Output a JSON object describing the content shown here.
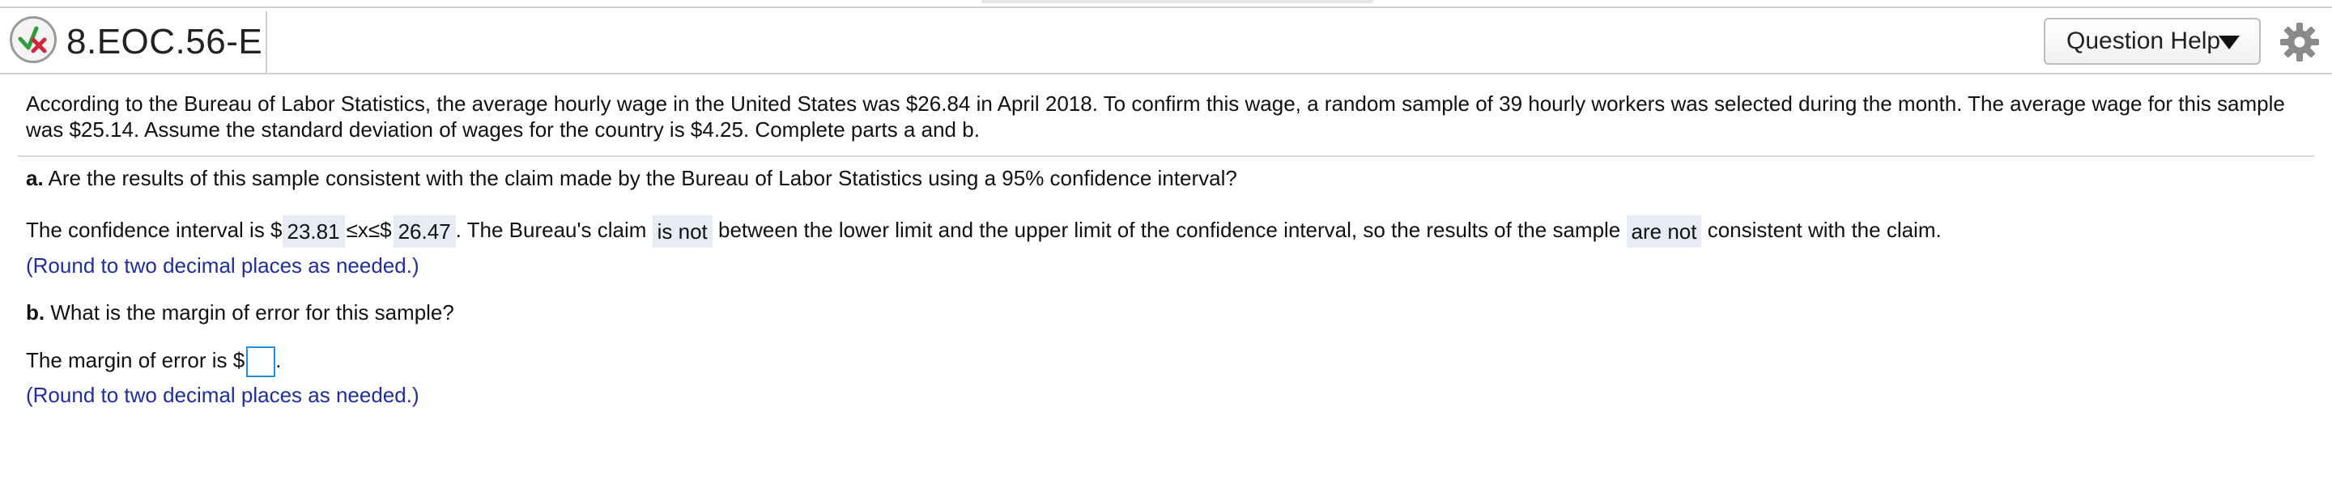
{
  "header": {
    "question_id": "8.EOC.56-E",
    "help_label": "Question Help",
    "icons": {
      "status": "partial-correct-check-x-icon",
      "help_caret": "caret-down-icon",
      "settings": "gear-icon"
    }
  },
  "problem": {
    "intro": "According to the Bureau of Labor Statistics, the average hourly wage in the United States was $26.84 in April 2018. To confirm this wage, a random sample of 39 hourly workers was selected during the month. The average wage for this sample was $25.14. Assume the standard deviation of wages for the country is $4.25. Complete parts a and b."
  },
  "part_a": {
    "label": "a.",
    "question": " Are the results of this sample consistent with the claim made by the Bureau of Labor Statistics using a 95% confidence interval?",
    "prefix": "The confidence interval is $",
    "lower_value": "23.81",
    "inequality": "≤x≤$",
    "upper_value": "26.47",
    "mid_text": ". The Bureau's claim",
    "claim_answer": "is not",
    "mid_text2": "between the lower limit and the upper limit of the confidence interval, so the results of the sample",
    "consistency_answer": "are not",
    "suffix": "consistent with the claim.",
    "hint": "(Round to two decimal places as needed.)"
  },
  "part_b": {
    "label": "b.",
    "question": " What is the margin of error for this sample?",
    "prefix": "The margin of error is $",
    "answer_value": "",
    "suffix": ".",
    "hint": "(Round to two decimal places as needed.)"
  },
  "colors": {
    "hint_text": "#1f2e9c",
    "answer_bg": "#e7ecf4",
    "input_border": "#2a8fd6",
    "check_green": "#2e9e3a",
    "x_red": "#d0283a"
  }
}
